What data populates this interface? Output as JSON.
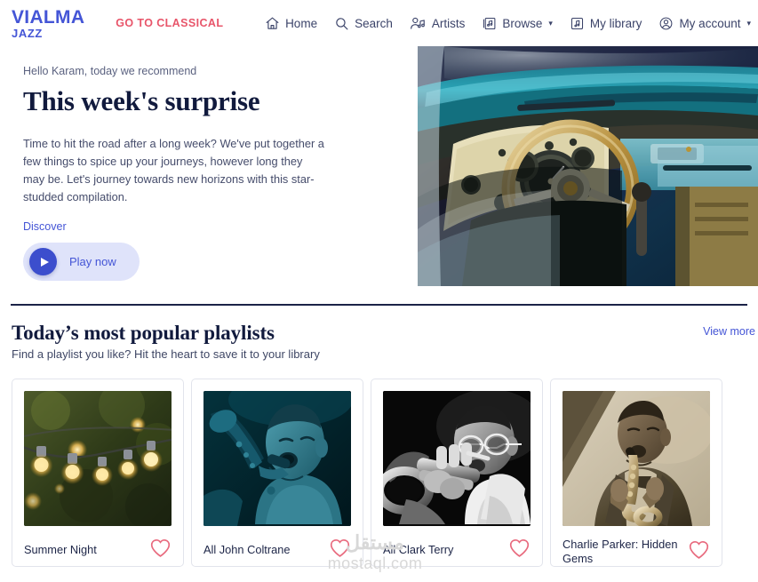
{
  "brand": {
    "logo_main": "VIALMA",
    "logo_sub": "JAZZ",
    "switch_label": "GO TO CLASSICAL",
    "accent_blue": "#4455d6",
    "accent_red": "#e8556a",
    "heart_color": "#e8697d",
    "play_pill_bg": "#dfe3fa",
    "play_circle_bg": "#3c4ecd"
  },
  "nav": {
    "items": [
      {
        "label": "Home",
        "icon": "home-icon",
        "caret": ""
      },
      {
        "label": "Search",
        "icon": "search-icon",
        "caret": ""
      },
      {
        "label": "Artists",
        "icon": "artists-icon",
        "caret": ""
      },
      {
        "label": "Browse",
        "icon": "browse-icon",
        "caret": "▾"
      },
      {
        "label": "My library",
        "icon": "library-icon",
        "caret": ""
      },
      {
        "label": "My account",
        "icon": "account-icon",
        "caret": "▾"
      }
    ]
  },
  "hero": {
    "greeting": "Hello Karam, today we recommend",
    "title": "This week's surprise",
    "body": "Time to hit the road after a long week? We've put together a few things to spice up your journeys, however long they may be. Let's journey towards new horizons with this star-studded compilation.",
    "discover_label": "Discover",
    "play_label": "Play now",
    "image_alt": "vintage turquoise car dashboard with wooden steering wheel"
  },
  "playlists_section": {
    "title": "Today’s most popular playlists",
    "subtitle": "Find a playlist you like? Hit the heart to save it to your library",
    "view_more_label": "View more",
    "cards": [
      {
        "name": "Summer Night",
        "art": "string-lights",
        "heart_icon": "heart-outline-icon"
      },
      {
        "name": "All John Coltrane",
        "art": "coltrane-teal",
        "heart_icon": "heart-outline-icon"
      },
      {
        "name": "All Clark Terry",
        "art": "clark-terry-bw",
        "heart_icon": "heart-outline-icon"
      },
      {
        "name": "Charlie Parker: Hidden Gems",
        "art": "charlie-parker-sepia",
        "heart_icon": "heart-outline-icon"
      }
    ]
  },
  "watermark": {
    "arabic": "مستقل",
    "latin": "mostaql.com"
  }
}
